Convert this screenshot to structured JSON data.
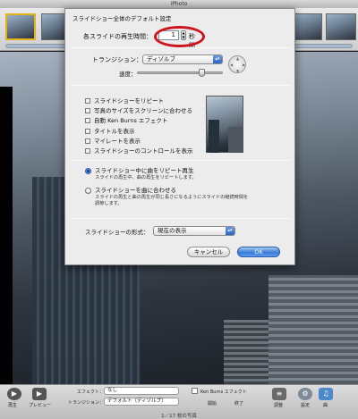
{
  "app": {
    "title": "iPhoto"
  },
  "dialog": {
    "title": "スライドショー全体のデフォルト設定",
    "duration": {
      "label": "各スライドの再生時間：",
      "value": "1",
      "unit": "秒間"
    },
    "transition": {
      "label": "トランジション：",
      "selected": "ディゾルブ"
    },
    "speed": {
      "label": "速度：",
      "level_fraction": 0.78
    },
    "options": [
      {
        "label": "スライドショーをリピート",
        "checked": false
      },
      {
        "label": "写真のサイズをスクリーンに合わせる",
        "checked": false
      },
      {
        "label": "自動 Ken Burns エフェクト",
        "checked": false
      },
      {
        "label": "タイトルを表示",
        "checked": false
      },
      {
        "label": "マイレートを表示",
        "checked": false
      },
      {
        "label": "スライドショーのコントロールを表示",
        "checked": false
      }
    ],
    "music": [
      {
        "label": "スライドショー中に曲をリピート再生",
        "desc": "スライドの再生中、曲の再生をリピートします。",
        "desc2": "",
        "selected": true
      },
      {
        "label": "スライドショーを曲に合わせる",
        "desc": "スライドの再生と曲の再生が同じ長さになるようにスライドの継続時間を",
        "desc2": "調節します。",
        "selected": false
      }
    ],
    "format": {
      "label": "スライドショーの形式：",
      "selected": "現在の表示"
    },
    "cancel_label": "キャンセル",
    "ok_label": "OK"
  },
  "bottombar": {
    "play_label": "再生",
    "preview_label": "プレビュー",
    "effect_label": "エフェクト：",
    "effect_value": "なし",
    "transition_label": "トランジション：",
    "transition_value": "デフォルト（ディゾルブ）",
    "kenburns_label": "Ken Burns エフェクト",
    "start_label": "開始",
    "end_label": "終了",
    "adjust_label": "調整",
    "settings_label": "設定",
    "music_label": "曲",
    "status": "1／17 枚の写真"
  },
  "colors": {
    "highlight": "#d0141d",
    "accent": "#3a7bd6"
  }
}
